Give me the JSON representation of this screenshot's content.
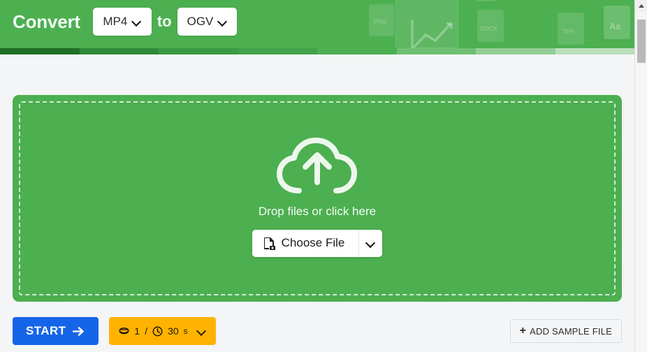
{
  "header": {
    "convert_label": "Convert",
    "to_label": "to",
    "source_format": "MP4",
    "target_format": "OGV",
    "source_caret": "chevron-down",
    "target_caret": "chevron-down",
    "decorative_tags": [
      "PNG",
      "DOCX",
      "TIFF",
      "Aa"
    ],
    "background_color": "#4caf50",
    "steps": [
      "#1e6e28",
      "#2f8a39",
      "#3b9a43",
      "#43a24a",
      "#4caf50",
      "#6fbf72",
      "#93cf95",
      "#bcdfbc"
    ]
  },
  "dropzone": {
    "icon": "cloud-upload-icon",
    "message": "Drop files or click here",
    "choose_file_label": "Choose File",
    "choose_file_icon": "file-add-icon",
    "choose_caret_icon": "chevron-down-icon",
    "panel_color": "#4caf50",
    "border_style": "dashed"
  },
  "footer": {
    "start_label": "START",
    "start_icon": "arrow-right-icon",
    "start_color": "#1565e8",
    "credits": {
      "coin_icon": "coin-icon",
      "count": "1",
      "separator": "/",
      "clock_icon": "clock-icon",
      "duration": "30",
      "duration_unit": "s",
      "caret_icon": "chevron-down-icon",
      "color": "#ffb300"
    },
    "add_sample_label": "ADD SAMPLE FILE",
    "add_sample_icon": "plus-icon"
  },
  "scrollbar": {
    "up_arrow_icon": "triangle-up-icon",
    "orientation": "vertical"
  },
  "page": {
    "background_color": "#f4f5f7"
  }
}
